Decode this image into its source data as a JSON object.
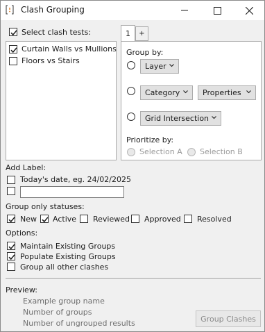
{
  "window": {
    "title": "Clash Grouping"
  },
  "select_tests": {
    "label": "Select clash tests:",
    "checked": true,
    "items": [
      {
        "label": "Curtain Walls vs Mullions",
        "checked": true
      },
      {
        "label": "Floors vs Stairs",
        "checked": false
      }
    ]
  },
  "tabs": {
    "items": [
      "1"
    ],
    "add_label": "+"
  },
  "group_by": {
    "label": "Group by:",
    "options": [
      {
        "selected": false,
        "dropdowns": [
          "Layer"
        ]
      },
      {
        "selected": false,
        "dropdowns": [
          "Category",
          "Properties"
        ]
      },
      {
        "selected": false,
        "dropdowns": [
          "Grid Intersection"
        ]
      }
    ]
  },
  "prioritize": {
    "label": "Prioritize by:",
    "options": [
      "Selection A",
      "Selection B"
    ]
  },
  "add_label": {
    "label": "Add Label:",
    "todays_date_label": "Today's date, eg. 24/02/2025",
    "todays_date_checked": false,
    "custom_checked": false,
    "custom_value": ""
  },
  "statuses": {
    "label": "Group only statuses:",
    "items": [
      {
        "label": "New",
        "checked": true
      },
      {
        "label": "Active",
        "checked": true
      },
      {
        "label": "Reviewed",
        "checked": false
      },
      {
        "label": "Approved",
        "checked": false
      },
      {
        "label": "Resolved",
        "checked": false
      }
    ]
  },
  "options": {
    "label": "Options:",
    "items": [
      {
        "label": "Maintain Existing Groups",
        "checked": true
      },
      {
        "label": "Populate Existing Groups",
        "checked": true
      },
      {
        "label": "Group all other clashes",
        "checked": false
      }
    ]
  },
  "preview": {
    "label": "Preview:",
    "lines": [
      "Example group name",
      "Number of groups",
      "Number of ungrouped results"
    ]
  },
  "actions": {
    "group_button": "Group Clashes"
  }
}
